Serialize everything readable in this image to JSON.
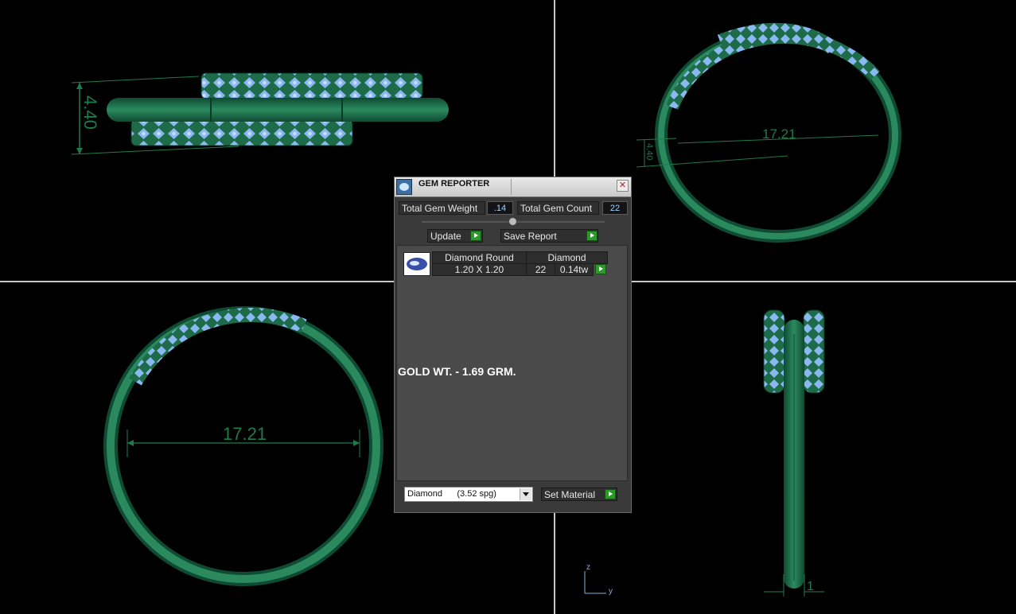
{
  "viewport": {
    "top_left": {
      "dimension": "4.40"
    },
    "top_right": {
      "dimensions": [
        "17.21",
        "4.40"
      ]
    },
    "bottom_left": {
      "dimension": "17.21"
    },
    "bottom_right": {
      "dimension": "1"
    },
    "axis": {
      "z": "z",
      "y": "y"
    }
  },
  "gem_reporter": {
    "title": "GEM REPORTER",
    "total_gem_weight_label": "Total Gem Weight",
    "total_gem_weight_value": ".14",
    "total_gem_count_label": "Total Gem Count",
    "total_gem_count_value": "22",
    "update_label": "Update",
    "save_report_label": "Save Report",
    "gem_rows": [
      {
        "name": "Diamond Round",
        "size": "1.20 X 1.20",
        "material": "Diamond",
        "count": "22",
        "weight": "0.14tw"
      }
    ],
    "note": "GOLD WT. - 1.69 GRM.",
    "material_select": "Diamond      (3.52 spg)",
    "set_material_label": "Set Material"
  },
  "colors": {
    "ring_green": "#1f6e4a",
    "gem_blue": "#8ab8f0",
    "panel_bg": "#3a3a3a"
  }
}
